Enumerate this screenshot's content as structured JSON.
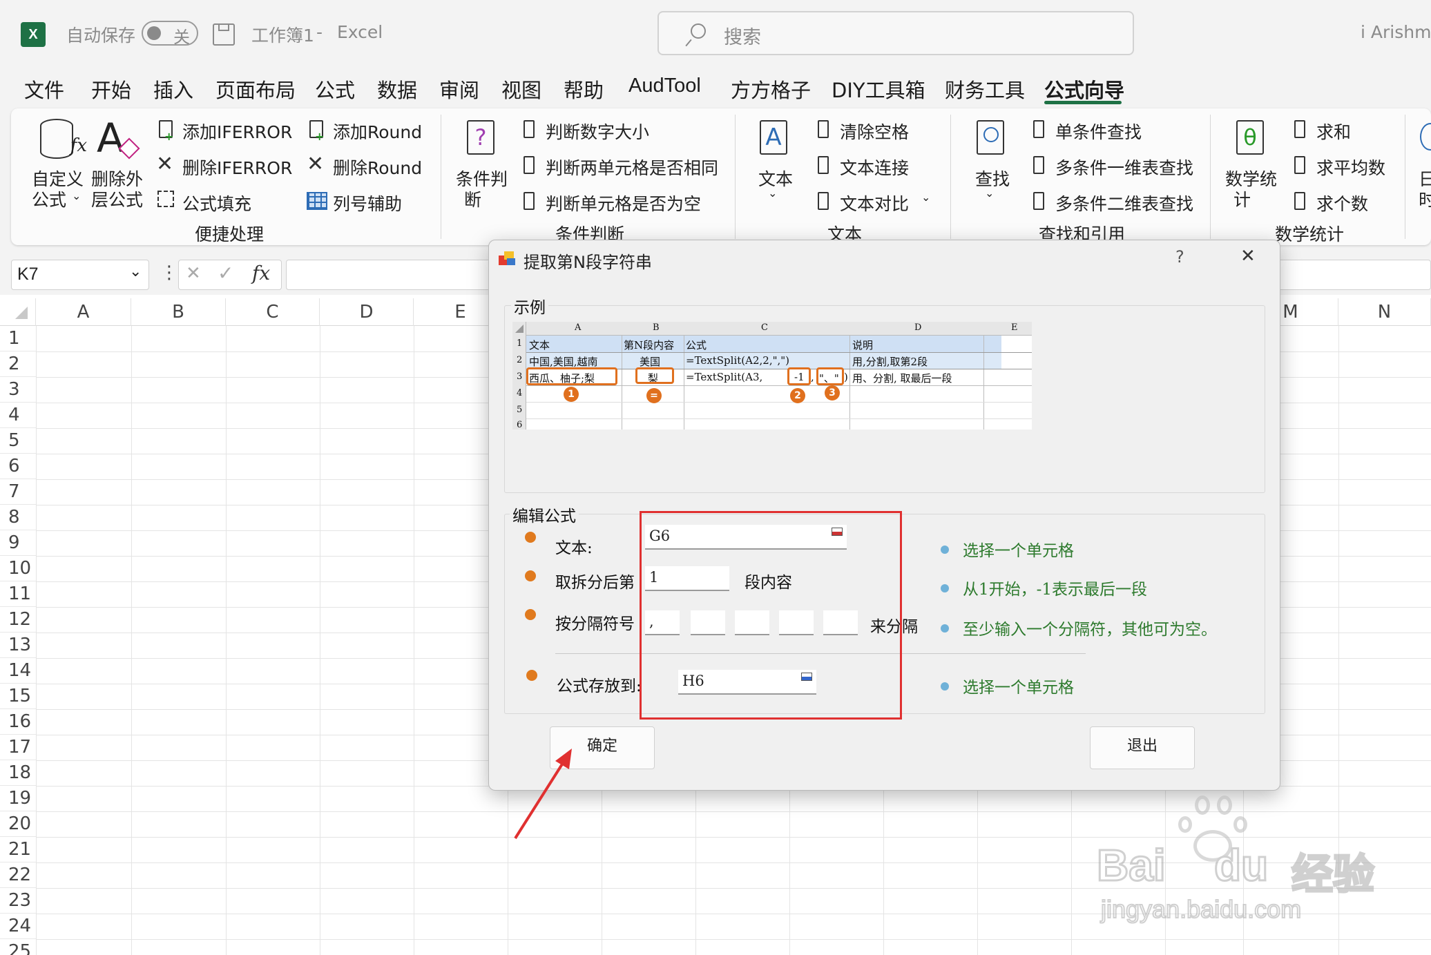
{
  "titlebar": {
    "autosave_label": "自动保存",
    "autosave_state": "关",
    "workbook": "工作簿1",
    "separator": "-",
    "app": "Excel",
    "search_placeholder": "搜索",
    "user": "i Arishmi"
  },
  "menu": [
    "文件",
    "开始",
    "插入",
    "页面布局",
    "公式",
    "数据",
    "审阅",
    "视图",
    "帮助",
    "AudTool",
    "方方格子",
    "DIY工具箱",
    "财务工具",
    "公式向导"
  ],
  "ribbon": {
    "g1": {
      "custom_line1": "自定义",
      "custom_line2": "公式",
      "remove_line1": "删除外",
      "remove_line2": "层公式",
      "add_iferror": "添加IFERROR",
      "del_iferror": "删除IFERROR",
      "fill": "公式填充",
      "add_round": "添加Round",
      "del_round": "删除Round",
      "col_helper": "列号辅助",
      "label": "便捷处理"
    },
    "g2": {
      "big_line1": "条件判",
      "big_line2": "断",
      "i1": "判断数字大小",
      "i2": "判断两单元格是否相同",
      "i3": "判断单元格是否为空",
      "label": "条件判断"
    },
    "g3": {
      "big": "文本",
      "i1": "清除空格",
      "i2": "文本连接",
      "i3": "文本对比",
      "label": "文本"
    },
    "g4": {
      "big": "查找",
      "i1": "单条件查找",
      "i2": "多条件一维表查找",
      "i3": "多条件二维表查找",
      "label": "查找和引用"
    },
    "g5": {
      "big_line1": "数学统",
      "big_line2": "计",
      "i1": "求和",
      "i2": "求平均数",
      "i3": "求个数",
      "label": "数学统计"
    },
    "g6": {
      "line1": "日",
      "line2": "时"
    }
  },
  "formula_bar": {
    "namebox": "K7",
    "fx": "fx"
  },
  "columns": [
    "A",
    "B",
    "C",
    "D",
    "E",
    "M",
    "N"
  ],
  "rows": [
    "1",
    "2",
    "3",
    "4",
    "5",
    "6",
    "7",
    "8",
    "9",
    "10",
    "11",
    "12",
    "13",
    "14",
    "15",
    "16",
    "17",
    "18",
    "19",
    "20",
    "21",
    "22",
    "23",
    "24",
    "25"
  ],
  "dialog": {
    "title": "提取第N段字符串",
    "help": "?",
    "example_label": "示例",
    "example": {
      "cols": [
        "A",
        "B",
        "C",
        "D",
        "E"
      ],
      "rownums": [
        "1",
        "2",
        "3",
        "4",
        "5",
        "6"
      ],
      "r1": [
        "文本",
        "第N段内容",
        "公式",
        "说明"
      ],
      "r2": [
        "中国,美国,越南",
        "美国",
        "=TextSplit(A2,2,\",\")",
        "用,分割,取第2段"
      ],
      "r3": [
        "西瓜、柚子;梨",
        "梨",
        "=TextSplit(A3,",
        "-1",
        ",",
        ")",
        "用、分割, 取最后一段"
      ],
      "sep3": "\"、\"",
      "marks": [
        "1",
        "=",
        "2",
        "3"
      ]
    },
    "edit_label": "编辑公式",
    "text_label": "文本:",
    "text_value": "G6",
    "text_hint": "选择一个单元格",
    "seg_label": "取拆分后第",
    "seg_value": "1",
    "seg_suffix": "段内容",
    "seg_hint": "从1开始，-1表示最后一段",
    "sep_label": "按分隔符号",
    "sep_values": [
      ",",
      "",
      "",
      "",
      ""
    ],
    "sep_suffix": "来分隔",
    "sep_hint": "至少输入一个分隔符，其他可为空。",
    "store_label": "公式存放到:",
    "store_value": "H6",
    "store_hint": "选择一个单元格",
    "ok": "确定",
    "exit": "退出"
  },
  "watermark": {
    "brand": "Bai",
    "brand2": "du",
    "cn": "经验",
    "url": "jingyan.baidu.com"
  },
  "colors": {
    "excel_green": "#1e7145",
    "orange": "#e0701e",
    "red_box": "#e03030",
    "hint_green": "#2d7a2d"
  }
}
